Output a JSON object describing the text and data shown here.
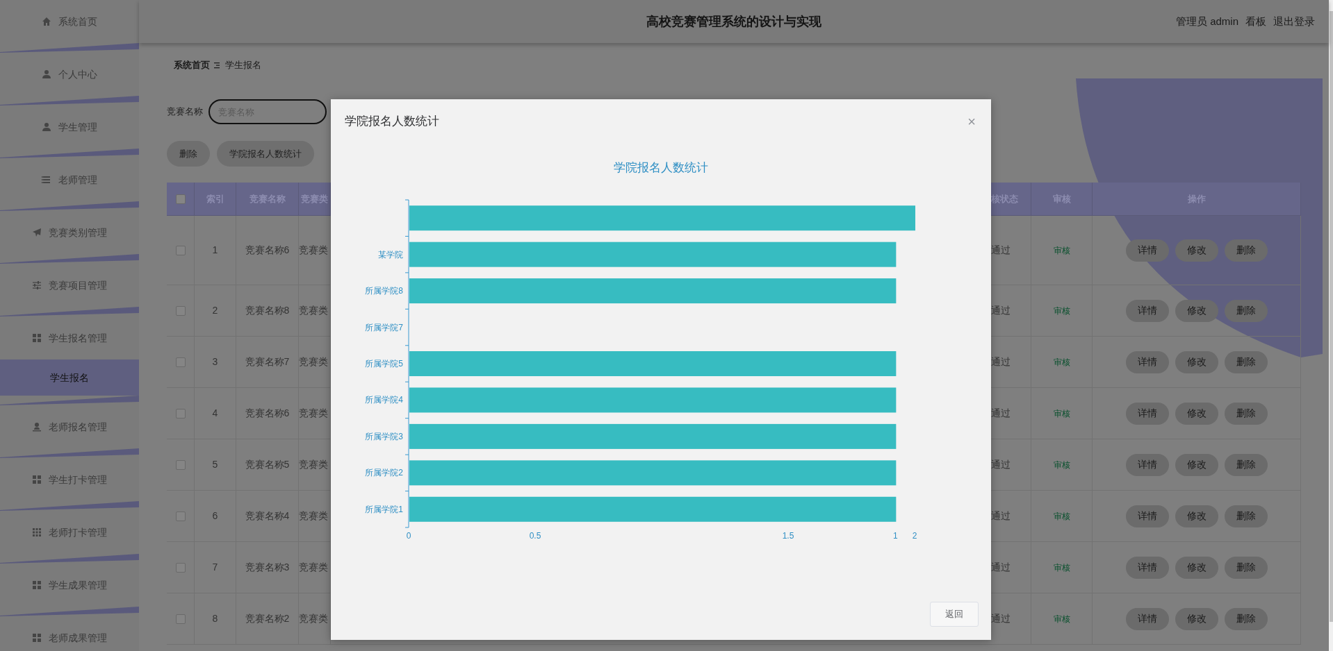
{
  "sidebar": {
    "items": [
      {
        "label": "系统首页",
        "selected": false
      },
      {
        "label": "个人中心",
        "selected": false
      },
      {
        "label": "学生管理",
        "selected": false
      },
      {
        "label": "老师管理",
        "selected": false
      },
      {
        "label": "竞赛类别管理",
        "selected": false
      },
      {
        "label": "竞赛项目管理",
        "selected": false
      },
      {
        "label": "学生报名管理",
        "selected": false,
        "children": [
          {
            "label": "学生报名",
            "selected": true
          }
        ]
      },
      {
        "label": "老师报名管理",
        "selected": false
      },
      {
        "label": "学生打卡管理",
        "selected": false
      },
      {
        "label": "老师打卡管理",
        "selected": false
      },
      {
        "label": "学生成果管理",
        "selected": false
      },
      {
        "label": "老师成果管理",
        "selected": false
      }
    ]
  },
  "header": {
    "title": "高校竞赛管理系统的设计与实现",
    "user": "管理员 admin",
    "links": [
      "看板",
      "退出登录"
    ]
  },
  "breadcrumb": [
    "系统首页",
    "学生报名"
  ],
  "filter": {
    "label": "竞赛名称",
    "placeholder": "竞赛名称"
  },
  "actions": [
    "删除",
    "学院报名人数统计"
  ],
  "table": {
    "all_checked": false,
    "columns": [
      "索引",
      "竞赛名称",
      "竞赛类",
      "核状态",
      "审核",
      "操作"
    ],
    "rows": [
      {
        "checked": false,
        "index": "1",
        "name": "竞赛名称6",
        "category": "竞赛类",
        "status": "通过",
        "review": "审核",
        "buttons": [
          "详情",
          "修改",
          "删除"
        ]
      },
      {
        "checked": false,
        "index": "2",
        "name": "竞赛名称8",
        "category": "竞赛类",
        "status": "通过",
        "review": "审核",
        "buttons": [
          "详情",
          "修改",
          "删除"
        ]
      },
      {
        "checked": false,
        "index": "3",
        "name": "竞赛名称7",
        "category": "竞赛类",
        "status": "通过",
        "review": "审核",
        "buttons": [
          "详情",
          "修改",
          "删除"
        ]
      },
      {
        "checked": false,
        "index": "4",
        "name": "竞赛名称6",
        "category": "竞赛类",
        "status": "通过",
        "review": "审核",
        "buttons": [
          "详情",
          "修改",
          "删除"
        ]
      },
      {
        "checked": false,
        "index": "5",
        "name": "竞赛名称5",
        "category": "竞赛类",
        "status": "通过",
        "review": "审核",
        "buttons": [
          "详情",
          "修改",
          "删除"
        ]
      },
      {
        "checked": false,
        "index": "6",
        "name": "竞赛名称4",
        "category": "竞赛类",
        "status": "通过",
        "review": "审核",
        "buttons": [
          "详情",
          "修改",
          "删除"
        ]
      },
      {
        "checked": false,
        "index": "7",
        "name": "竞赛名称3",
        "category": "竞赛类",
        "status": "通过",
        "review": "审核",
        "buttons": [
          "详情",
          "修改",
          "删除"
        ]
      },
      {
        "checked": false,
        "index": "8",
        "name": "竞赛名称2",
        "category": "竞赛类",
        "status": "通过",
        "review": "审核",
        "buttons": [
          "详情",
          "修改",
          "删除"
        ]
      }
    ]
  },
  "dialog": {
    "title": "学院报名人数统计",
    "close": "×",
    "buttons": [
      "返回"
    ],
    "chart": {
      "title": "学院报名人数统计",
      "bars": [
        {
          "level": 1
        },
        {
          "label": "某学院",
          "level": 0.962
        },
        {
          "label": "所属学院8",
          "level": 0.962
        },
        {
          "label": "所属学院7"
        },
        {
          "label": "所属学院5",
          "level": 0.962
        },
        {
          "label": "所属学院4",
          "level": 0.962
        },
        {
          "label": "所属学院3",
          "level": 0.962
        },
        {
          "label": "所属学院2",
          "level": 0.962
        },
        {
          "label": "所属学院1",
          "level": 0.962
        }
      ],
      "x_labels": [
        "0",
        "0.5",
        "1.5",
        "1",
        "2"
      ]
    }
  }
}
